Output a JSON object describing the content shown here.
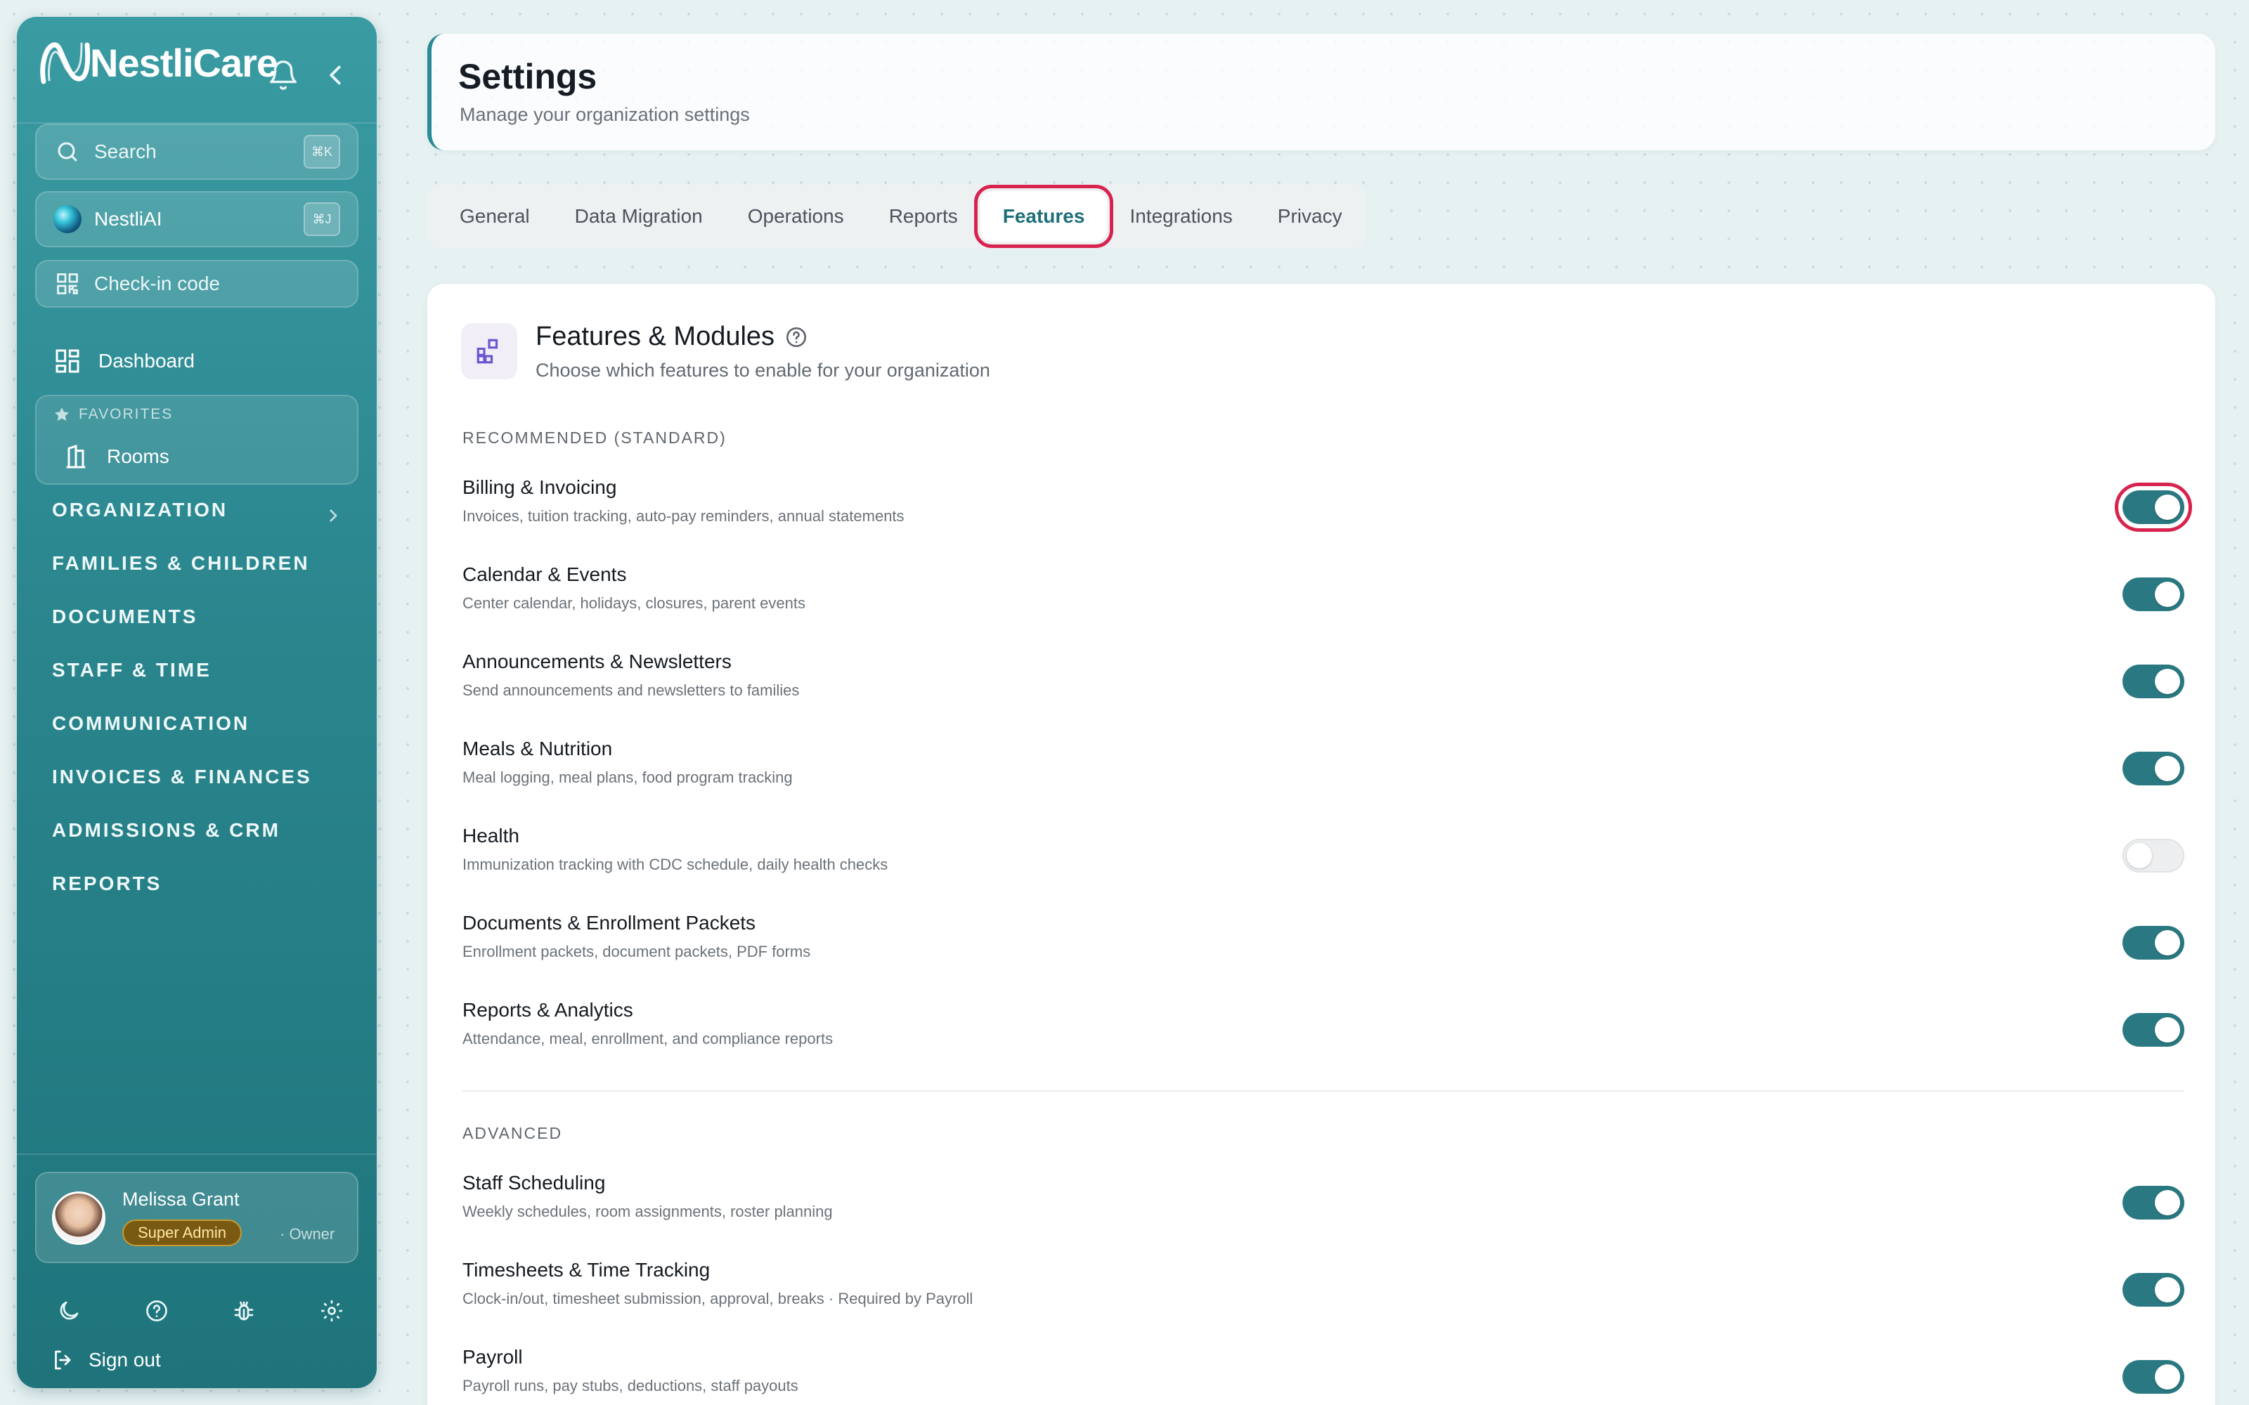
{
  "brand": {
    "name": "NestliCare"
  },
  "sidebar": {
    "search": {
      "label": "Search",
      "shortcut": "⌘K"
    },
    "ai": {
      "label": "NestliAI",
      "shortcut": "⌘J"
    },
    "checkin": {
      "label": "Check-in code"
    },
    "dashboard": {
      "label": "Dashboard"
    },
    "favorites": {
      "heading": "FAVORITES",
      "items": [
        {
          "label": "Rooms"
        }
      ]
    },
    "sections": [
      {
        "label": "ORGANIZATION"
      },
      {
        "label": "FAMILIES & CHILDREN"
      },
      {
        "label": "DOCUMENTS"
      },
      {
        "label": "STAFF & TIME"
      },
      {
        "label": "COMMUNICATION"
      },
      {
        "label": "INVOICES & FINANCES"
      },
      {
        "label": "ADMISSIONS & CRM"
      },
      {
        "label": "REPORTS"
      }
    ],
    "user": {
      "name": "Melissa Grant",
      "role": "Super Admin",
      "subrole": "· Owner"
    },
    "tools": [
      "moon-icon",
      "help-icon",
      "bug-icon",
      "gear-icon"
    ],
    "signout": {
      "label": "Sign out"
    }
  },
  "header": {
    "title": "Settings",
    "subtitle": "Manage your organization settings"
  },
  "tabs": [
    {
      "label": "General"
    },
    {
      "label": "Data Migration"
    },
    {
      "label": "Operations"
    },
    {
      "label": "Reports"
    },
    {
      "label": "Features",
      "active": true
    },
    {
      "label": "Integrations"
    },
    {
      "label": "Privacy"
    }
  ],
  "features_panel": {
    "title": "Features & Modules",
    "subtitle": "Choose which features to enable for your organization",
    "groups": [
      {
        "label": "RECOMMENDED (STANDARD)",
        "items": [
          {
            "name": "Billing & Invoicing",
            "desc": "Invoices, tuition tracking, auto-pay reminders, annual statements",
            "enabled": true
          },
          {
            "name": "Calendar & Events",
            "desc": "Center calendar, holidays, closures, parent events",
            "enabled": true
          },
          {
            "name": "Announcements & Newsletters",
            "desc": "Send announcements and newsletters to families",
            "enabled": true
          },
          {
            "name": "Meals & Nutrition",
            "desc": "Meal logging, meal plans, food program tracking",
            "enabled": true
          },
          {
            "name": "Health",
            "desc": "Immunization tracking with CDC schedule, daily health checks",
            "enabled": false
          },
          {
            "name": "Documents & Enrollment Packets",
            "desc": "Enrollment packets, document packets, PDF forms",
            "enabled": true
          },
          {
            "name": "Reports & Analytics",
            "desc": "Attendance, meal, enrollment, and compliance reports",
            "enabled": true
          }
        ]
      },
      {
        "label": "ADVANCED",
        "items": [
          {
            "name": "Staff Scheduling",
            "desc": "Weekly schedules, room assignments, roster planning",
            "enabled": true
          },
          {
            "name": "Timesheets & Time Tracking",
            "desc": "Clock-in/out, timesheet submission, approval, breaks · Required by Payroll",
            "enabled": true
          },
          {
            "name": "Payroll",
            "desc": "Payroll runs, pay stubs, deductions, staff payouts",
            "enabled": true
          }
        ]
      }
    ]
  },
  "colors": {
    "accent": "#2a7982",
    "highlight": "#d8234f",
    "sidebar": "#2a858d"
  }
}
